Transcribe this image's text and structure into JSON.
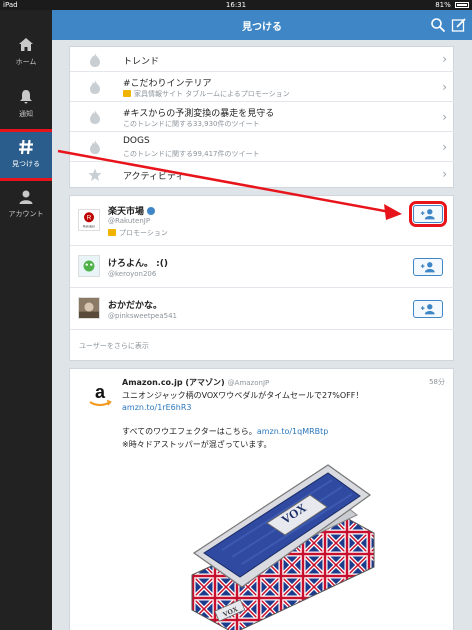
{
  "status": {
    "device": "iPad",
    "time": "16:31",
    "battery": "81%"
  },
  "sidebar": {
    "items": [
      {
        "label": "ホーム",
        "icon": "home-icon"
      },
      {
        "label": "通知",
        "icon": "bell-icon"
      },
      {
        "label": "見つける",
        "icon": "hash-icon",
        "active": true
      },
      {
        "label": "アカウント",
        "icon": "person-icon"
      }
    ]
  },
  "header": {
    "title": "見つける"
  },
  "trends": {
    "items": [
      {
        "title": "トレンド",
        "subtitle": "",
        "icon": "flame-icon"
      },
      {
        "title": "#こだわりインテリア",
        "subtitle": "家具情報サイト タブルームによるプロモーション",
        "promoted": true,
        "icon": "flame-icon"
      },
      {
        "title": "#キスからの予測変換の暴走を見守る",
        "subtitle": "このトレンドに関する33,930件のツイート",
        "icon": "flame-icon"
      },
      {
        "title": "DOGS",
        "subtitle": "このトレンドに関する99,417件のツイート",
        "icon": "flame-icon"
      },
      {
        "title": "アクティビティ",
        "subtitle": "",
        "icon": "star-icon"
      }
    ]
  },
  "suggestions": {
    "users": [
      {
        "name": "楽天市場",
        "handle": "@RakutenJP",
        "promo": "プロモーション",
        "verified": true,
        "avatar_text": "Rakuten"
      },
      {
        "name": "けろよん。 :()",
        "handle": "@keroyon206"
      },
      {
        "name": "おかだかな。",
        "handle": "@pinksweetpea541"
      }
    ],
    "more_label": "ユーザーをさらに表示"
  },
  "tweet": {
    "name": "Amazon.co.jp (アマゾン)",
    "handle": "@AmazonJP",
    "time": "58分",
    "line1": "ユニオンジャック柄のVOXワウペダルがタイムセールで27%OFF！",
    "link1": "amzn.to/1rE6hR3",
    "line3_prefix": "すべてのワウエフェクターはこちら。",
    "link2": "amzn.to/1qMRBtp",
    "line4": "※時々ドアストッパーが混ざっています。",
    "image_brand": "VOX"
  },
  "colors": {
    "accent": "#3e86c6",
    "highlight": "#e8141b"
  }
}
